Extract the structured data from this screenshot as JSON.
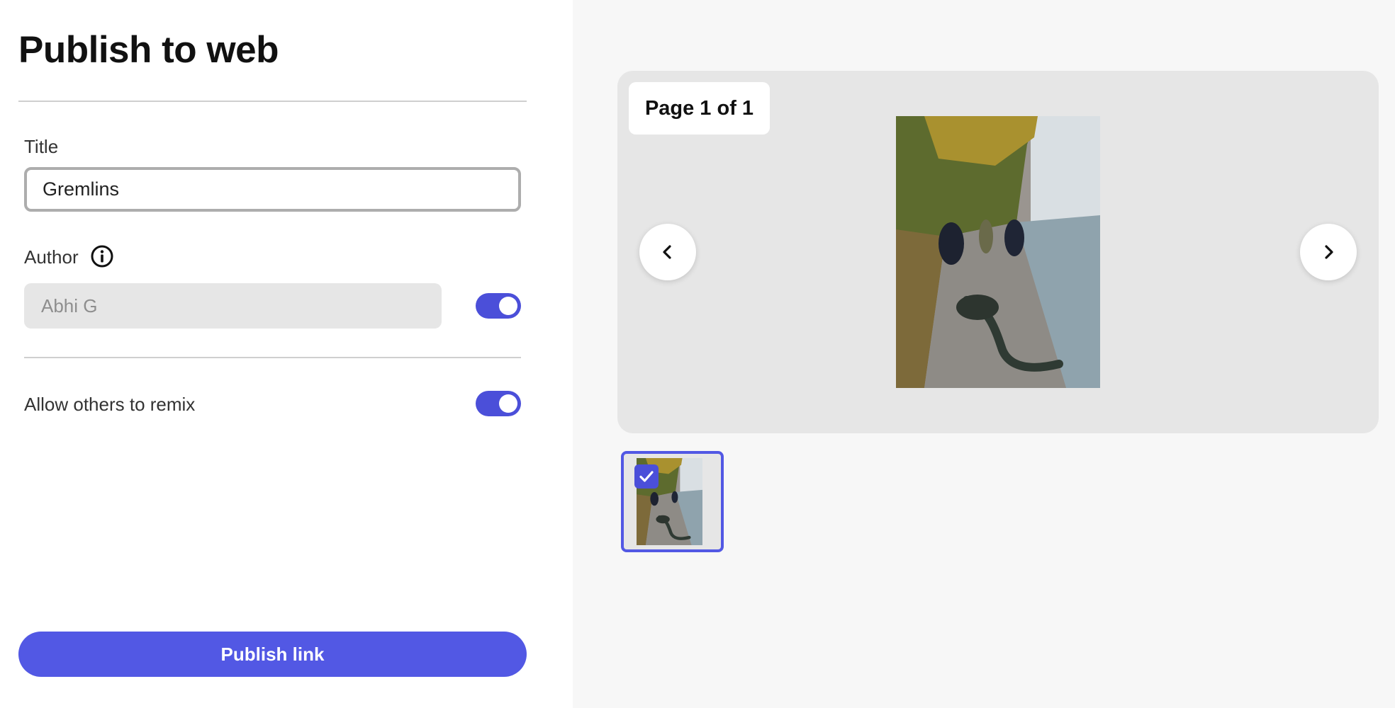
{
  "panel": {
    "title": "Publish to web",
    "title_field": {
      "label": "Title",
      "value": "Gremlins"
    },
    "author_field": {
      "label": "Author",
      "value": "Abhi G",
      "visible_toggle_on": true
    },
    "remix": {
      "label": "Allow others to remix",
      "toggle_on": true
    },
    "publish_button": "Publish link"
  },
  "preview": {
    "page_indicator": "Page 1 of 1",
    "thumbnails": [
      {
        "selected": true
      }
    ]
  },
  "colors": {
    "accent": "#5258e4",
    "toggle": "#4b4fd9",
    "preview_bg": "#e6e6e6",
    "panel_bg": "#f7f7f7"
  },
  "icons": {
    "info": "info-icon",
    "prev": "chevron-left-icon",
    "next": "chevron-right-icon",
    "check": "checkmark-icon"
  }
}
